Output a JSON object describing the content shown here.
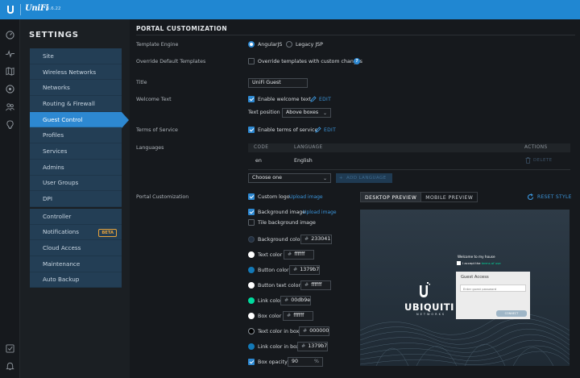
{
  "app": {
    "version": "5.6.22"
  },
  "settings": {
    "title": "SETTINGS",
    "menu_groups": [
      [
        "Site",
        "Wireless Networks",
        "Networks",
        "Routing & Firewall",
        "Guest Control",
        "Profiles",
        "Services",
        "Admins",
        "User Groups",
        "DPI"
      ],
      [
        "Controller",
        "Notifications",
        "Cloud Access",
        "Maintenance",
        "Auto Backup"
      ]
    ],
    "active_item": "Guest Control",
    "beta_badge": "BETA"
  },
  "portal": {
    "section_title": "PORTAL CUSTOMIZATION",
    "template_engine": {
      "label": "Template Engine",
      "options": [
        "AngularJS",
        "Legacy JSP"
      ],
      "selected": "AngularJS"
    },
    "override": {
      "label": "Override Default Templates",
      "checkbox_label": "Override templates with custom changes",
      "checked": false,
      "help": "?"
    },
    "title": {
      "label": "Title",
      "value": "UniFi Guest"
    },
    "welcome": {
      "label": "Welcome Text",
      "checkbox_label": "Enable welcome text",
      "checked": true,
      "edit": "EDIT",
      "position_label": "Text position",
      "position_value": "Above boxes"
    },
    "tos": {
      "label": "Terms of Service",
      "checkbox_label": "Enable terms of service",
      "checked": true,
      "edit": "EDIT"
    },
    "languages": {
      "label": "Languages",
      "columns": [
        "CODE",
        "LANGUAGE",
        "ACTIONS"
      ],
      "rows": [
        {
          "code": "en",
          "language": "English",
          "action": "DELETE"
        }
      ],
      "choose_placeholder": "Choose one",
      "add_button": "ADD LANGUAGE"
    },
    "customization": {
      "label": "Portal Customization",
      "custom_logo": {
        "label": "Custom logo",
        "checked": true,
        "link": "Upload image"
      },
      "background_image": {
        "label": "Background image",
        "checked": true,
        "link": "Upload image"
      },
      "tile_background": {
        "label": "Tile background image",
        "checked": false
      },
      "colors": [
        {
          "label": "Background color",
          "value": "233041",
          "swatch": "#233041"
        },
        {
          "label": "Text color",
          "value": "ffffff",
          "swatch": "#ffffff"
        },
        {
          "label": "Button color",
          "value": "1379b7",
          "swatch": "#1379b7"
        },
        {
          "label": "Button text color",
          "value": "ffffff",
          "swatch": "#ffffff"
        },
        {
          "label": "Link color",
          "value": "00db9e",
          "swatch": "#00db9e"
        },
        {
          "label": "Box color",
          "value": "ffffff",
          "swatch": "#ffffff"
        },
        {
          "label": "Text color in box",
          "value": "000000",
          "swatch": "#000000"
        },
        {
          "label": "Link color in box",
          "value": "1379b7",
          "swatch": "#1379b7"
        }
      ],
      "box_opacity": {
        "label": "Box opacity",
        "checked": true,
        "value": "90",
        "unit": "%"
      }
    },
    "preview": {
      "tabs": [
        "DESKTOP PREVIEW",
        "MOBILE PREVIEW"
      ],
      "active_tab": "DESKTOP PREVIEW",
      "reset": "RESET STYLE",
      "logo_text": "UBIQUITI",
      "logo_sub": "NETWORKS",
      "welcome": "Welcome to my house",
      "accept_prefix": "I accept the",
      "accept_link": "terms of use",
      "box_title": "Guest Access",
      "password_placeholder": "Enter guest password",
      "connect": "CONNECT"
    }
  }
}
